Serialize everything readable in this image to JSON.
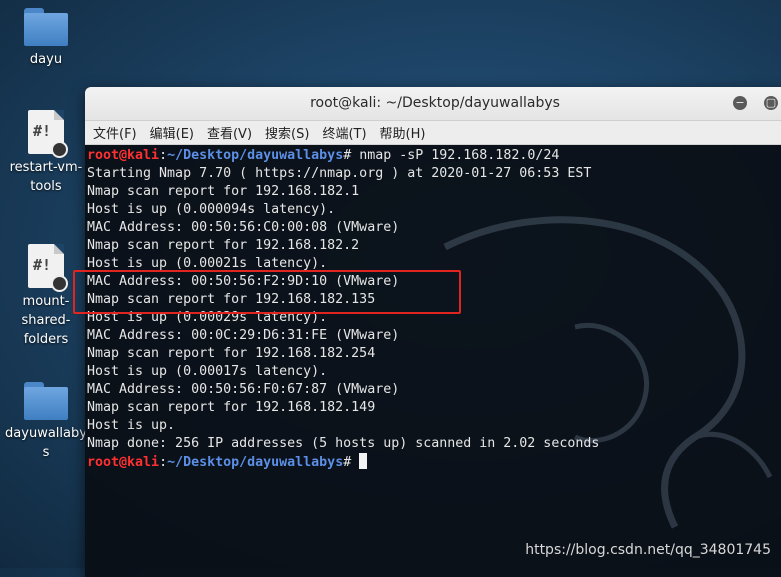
{
  "desktop": {
    "icons": [
      {
        "label": "dayu",
        "type": "folder"
      },
      {
        "label": "restart-vm-\ntools",
        "type": "script",
        "glyph": "#!"
      },
      {
        "label": "mount-\nshared-\nfolders",
        "type": "script",
        "glyph": "#!"
      },
      {
        "label": "dayuwallaby\ns",
        "type": "folder"
      }
    ]
  },
  "window": {
    "title": "root@kali: ~/Desktop/dayuwallabys",
    "buttons": {
      "minimize_icon": "−",
      "maximize_icon": "▢"
    },
    "menu": [
      "文件(F)",
      "编辑(E)",
      "查看(V)",
      "搜索(S)",
      "终端(T)",
      "帮助(H)"
    ]
  },
  "terminal": {
    "prompt_user": "root@kali",
    "prompt_sep": ":",
    "prompt_path": "~/Desktop/dayuwallabys",
    "prompt_symbol": "# ",
    "command": "nmap -sP 192.168.182.0/24",
    "output": [
      "Starting Nmap 7.70 ( https://nmap.org ) at 2020-01-27 06:53 EST",
      "Nmap scan report for 192.168.182.1",
      "Host is up (0.000094s latency).",
      "MAC Address: 00:50:56:C0:00:08 (VMware)",
      "Nmap scan report for 192.168.182.2",
      "Host is up (0.00021s latency).",
      "MAC Address: 00:50:56:F2:9D:10 (VMware)",
      "Nmap scan report for 192.168.182.135",
      "Host is up (0.00029s latency).",
      "MAC Address: 00:0C:29:D6:31:FE (VMware)",
      "Nmap scan report for 192.168.182.254",
      "Host is up (0.00017s latency).",
      "MAC Address: 00:50:56:F0:67:87 (VMware)",
      "Nmap scan report for 192.168.182.149",
      "Host is up.",
      "Nmap done: 256 IP addresses (5 hosts up) scanned in 2.02 seconds"
    ]
  },
  "watermark": "https://blog.csdn.net/qq_34801745",
  "colors": {
    "prompt_user": "#ff3030",
    "prompt_path": "#5c8fe6",
    "highlight": "#e0241f"
  }
}
